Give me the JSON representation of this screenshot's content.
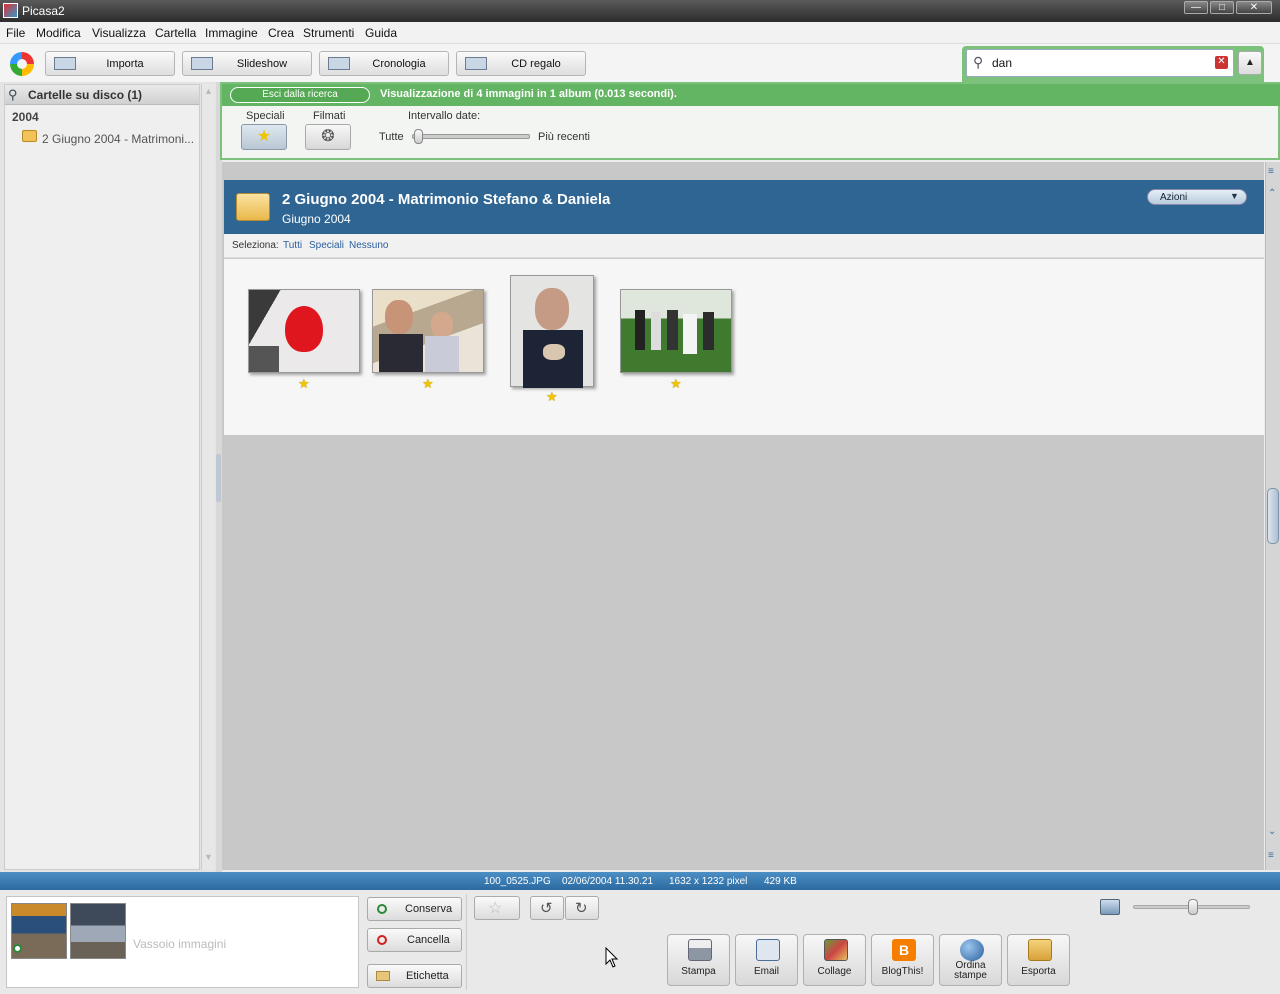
{
  "window": {
    "title": "Picasa2"
  },
  "menu": [
    "File",
    "Modifica",
    "Visualizza",
    "Cartella",
    "Immagine",
    "Crea",
    "Strumenti",
    "Guida"
  ],
  "toolbar": {
    "import": "Importa",
    "slideshow": "Slideshow",
    "timeline": "Cronologia",
    "gift_cd": "CD regalo"
  },
  "search": {
    "value": "dan"
  },
  "search_bar": {
    "exit_label": "Esci dalla ricerca",
    "result_text": "Visualizzazione di 4 immagini in 1 album (0.013 secondi).",
    "starred_label": "Speciali",
    "movies_label": "Filmati",
    "date_range_label": "Intervallo date:",
    "date_from": "Tutte",
    "date_to": "Più recenti",
    "date_slider_level": 0
  },
  "sidebar": {
    "header": "Cartelle su disco (1)",
    "year": "2004",
    "folder": "2 Giugno 2004 - Matrimoni..."
  },
  "album": {
    "title": "2 Giugno 2004 - Matrimonio Stefano & Daniela",
    "subtitle": "Giugno 2004",
    "actions_label": "Azioni",
    "select_label": "Seleziona:",
    "select_all": "Tutti",
    "select_starred": "Speciali",
    "select_none": "Nessuno",
    "photos": [
      {
        "name": "photo-heart-flag",
        "starred": true
      },
      {
        "name": "photo-men-at-table",
        "starred": true
      },
      {
        "name": "photo-man-eating",
        "starred": true
      },
      {
        "name": "photo-wedding-group",
        "starred": true
      }
    ]
  },
  "status": {
    "filename": "100_0525.JPG",
    "datetime": "02/06/2004 11.30.21",
    "dimensions": "1632 x 1232 pixel",
    "size": "429 KB"
  },
  "tray": {
    "placeholder": "Vassoio immagini"
  },
  "tray_buttons": {
    "hold": "Conserva",
    "clear": "Cancella",
    "label": "Etichetta"
  },
  "actions": [
    {
      "label": "Stampa",
      "icon": "printer-icon"
    },
    {
      "label": "Email",
      "icon": "email-icon"
    },
    {
      "label": "Collage",
      "icon": "collage-icon"
    },
    {
      "label": "BlogThis!",
      "icon": "blogger-icon"
    },
    {
      "label": "Ordina stampe",
      "icon": "globe-icon"
    },
    {
      "label": "Esporta",
      "icon": "export-icon"
    }
  ],
  "zoom": {
    "level": 0.5
  },
  "colors": {
    "accent_green": "#63b463",
    "album_header": "#2f6592",
    "status_blue": "#2b6aa0"
  }
}
